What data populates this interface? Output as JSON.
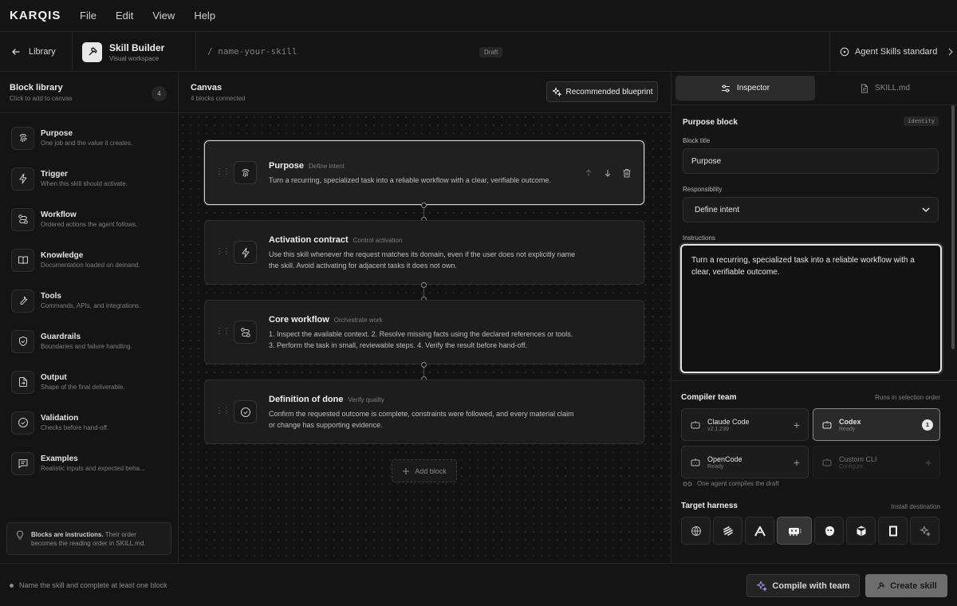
{
  "app": {
    "logo": "KARQIS",
    "menu": [
      "File",
      "Edit",
      "View",
      "Help"
    ]
  },
  "toolbar": {
    "back_label": "Library",
    "brand_title": "Skill Builder",
    "brand_sub": "Visual workspace",
    "skill_name": "/ name-your-skill",
    "draft": "Draft",
    "standard": "Agent Skills standard"
  },
  "sidebar": {
    "title": "Block library",
    "subtitle": "Click to add to canvas",
    "count": "4",
    "items": [
      {
        "name": "Purpose",
        "desc": "One job and the value it creates.",
        "icon": "fingerprint-icon"
      },
      {
        "name": "Trigger",
        "desc": "When this skill should activate.",
        "icon": "lightning-icon"
      },
      {
        "name": "Workflow",
        "desc": "Ordered actions the agent follows.",
        "icon": "workflow-icon"
      },
      {
        "name": "Knowledge",
        "desc": "Documentation loaded on demand.",
        "icon": "book-icon"
      },
      {
        "name": "Tools",
        "desc": "Commands, APIs, and integrations.",
        "icon": "wrench-icon"
      },
      {
        "name": "Guardrails",
        "desc": "Boundaries and failure handling.",
        "icon": "shield-icon"
      },
      {
        "name": "Output",
        "desc": "Shape of the final deliverable.",
        "icon": "export-icon"
      },
      {
        "name": "Validation",
        "desc": "Checks before hand-off.",
        "icon": "check-circle-icon"
      },
      {
        "name": "Examples",
        "desc": "Realistic inputs and expected beha...",
        "icon": "message-icon"
      }
    ],
    "tip_bold": "Blocks are instructions.",
    "tip_rest": " Their order becomes the reading order in SKILL.md."
  },
  "canvas": {
    "title": "Canvas",
    "subtitle": "4 blocks connected",
    "blueprint": "Recommended blueprint",
    "blocks": [
      {
        "title": "Purpose",
        "tag": "Define intent",
        "text": "Turn a recurring, specialized task into a reliable workflow with a clear, verifiable outcome."
      },
      {
        "title": "Activation contract",
        "tag": "Control activation",
        "text": "Use this skill whenever the request matches its domain, even if the user does not explicitly name the skill. Avoid activating for adjacent tasks it does not own."
      },
      {
        "title": "Core workflow",
        "tag": "Orchestrate work",
        "text": "1. Inspect the available context. 2. Resolve missing facts using the declared references or tools. 3. Perform the task in small, reviewable steps. 4. Verify the result before hand-off."
      },
      {
        "title": "Definition of done",
        "tag": "Verify quality",
        "text": "Confirm the requested outcome is complete, constraints were followed, and every material claim or change has supporting evidence."
      }
    ],
    "add_block": "Add block"
  },
  "inspector": {
    "tab_inspector": "Inspector",
    "tab_skill": "SKILL.md",
    "heading": "Purpose block",
    "identity": "identity",
    "block_title_label": "Block title",
    "block_title_value": "Purpose",
    "responsibility_label": "Responsibility",
    "responsibility_value": "Define intent",
    "instructions_label": "Instructions",
    "instructions_value": "Turn a recurring, specialized task into a reliable workflow with a clear, verifiable outcome."
  },
  "compiler": {
    "title": "Compiler team",
    "note": "Runs in selection order",
    "agents": [
      {
        "name": "Claude Code",
        "sub": "v2.1.239"
      },
      {
        "name": "Codex",
        "sub": "Ready",
        "badge": "1"
      },
      {
        "name": "OpenCode",
        "sub": "Ready"
      },
      {
        "name": "Custom CLI",
        "sub": "Configure"
      }
    ],
    "single_note": "One agent compiles the draft",
    "harness_title": "Target harness",
    "harness_note": "Install destination"
  },
  "footer": {
    "status": "Name the skill and complete at least one block",
    "compile": "Compile with team",
    "create": "Create skill"
  }
}
